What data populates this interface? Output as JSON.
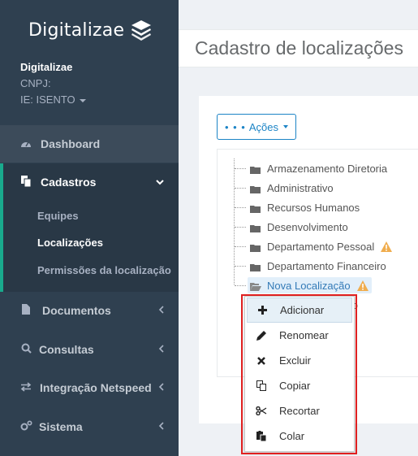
{
  "sidebar": {
    "logo_text": "Digitalizae",
    "company": {
      "name": "Digitalizae",
      "cnpj": "CNPJ:",
      "ie": "IE: ISENTO"
    },
    "nav": {
      "dashboard": "Dashboard",
      "cadastros": "Cadastros",
      "documentos": "Documentos",
      "consultas": "Consultas",
      "integracao": "Integração Netspeed",
      "sistema": "Sistema"
    },
    "sub_items": {
      "equipes": "Equipes",
      "localizacoes": "Localizações",
      "permissoes": "Permissões da localização"
    },
    "accent_color": "#19aa8d",
    "background_color": "#2f4050"
  },
  "main": {
    "page_title": "Cadastro de localizações",
    "actions_button": {
      "dots": "• • •",
      "label": "Ações"
    },
    "tree": [
      {
        "label": "Armazenamento Diretoria",
        "warning": false
      },
      {
        "label": "Administrativo",
        "warning": false
      },
      {
        "label": "Recursos Humanos",
        "warning": false
      },
      {
        "label": "Desenvolvimento",
        "warning": false
      },
      {
        "label": "Departamento Pessoal",
        "warning": true
      },
      {
        "label": "Departamento Financeiro",
        "warning": false
      },
      {
        "label": "Nova Localização",
        "warning": true,
        "selected": true
      }
    ],
    "hidden_node_fragment": "ção",
    "warning_color": "#f0ad4e",
    "accent_color": "#1c84c6"
  },
  "context_menu": {
    "items": [
      {
        "label": "Adicionar",
        "icon": "plus-icon"
      },
      {
        "label": "Renomear",
        "icon": "pencil-icon"
      },
      {
        "label": "Excluir",
        "icon": "times-icon"
      },
      {
        "label": "Copiar",
        "icon": "copy-icon"
      },
      {
        "label": "Recortar",
        "icon": "scissors-icon"
      },
      {
        "label": "Colar",
        "icon": "paste-icon"
      }
    ],
    "highlight_color": "#e02020"
  }
}
